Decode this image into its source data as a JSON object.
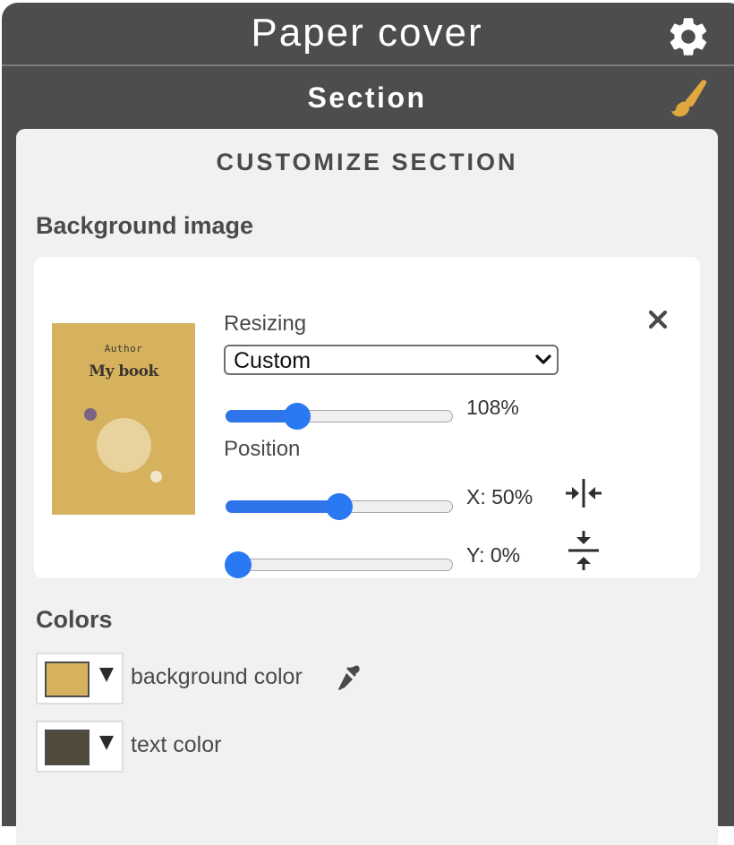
{
  "header": {
    "app_title": "Paper cover",
    "settings_icon": "gear-icon"
  },
  "section_bar": {
    "title": "Section",
    "style_icon": "paintbrush-icon",
    "accent_color": "#e0a83e"
  },
  "panel": {
    "title": "CUSTOMIZE SECTION",
    "background_image": {
      "heading": "Background image",
      "thumbnail": {
        "author": "Author",
        "title": "My book",
        "background": "#d6b25e"
      },
      "remove_icon": "close-icon",
      "resizing": {
        "label": "Resizing",
        "selected": "Custom",
        "scale_value": 0.29,
        "scale_text": "108%"
      },
      "position": {
        "label": "Position",
        "x_value": 0.5,
        "x_text": "X: 50%",
        "x_center_icon": "center-horizontal-icon",
        "y_value": 0.0,
        "y_text": "Y: 0%",
        "y_center_icon": "center-vertical-icon"
      }
    },
    "colors": {
      "heading": "Colors",
      "items": [
        {
          "label": "background color",
          "color": "#d6b25e",
          "has_eyedropper": true
        },
        {
          "label": "text color",
          "color": "#504a3c",
          "has_eyedropper": false
        }
      ]
    }
  },
  "theme": {
    "slider_color": "#2a79f2",
    "chrome_color": "#4d4d4d"
  }
}
